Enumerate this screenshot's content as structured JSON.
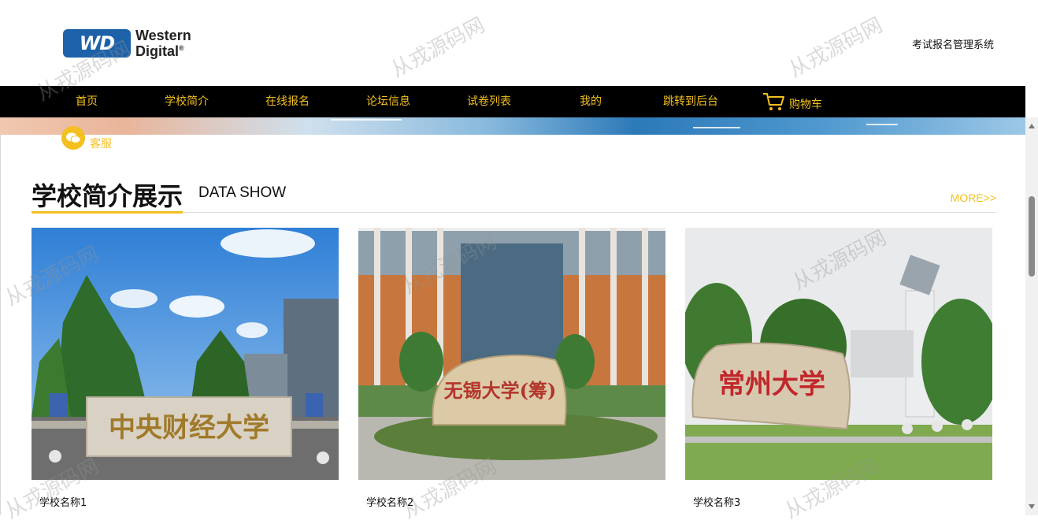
{
  "header": {
    "logo_badge": "WD",
    "logo_line1": "Western",
    "logo_line2": "Digital",
    "logo_mark": "®",
    "system_title": "考试报名管理系统"
  },
  "nav": {
    "items": [
      "首页",
      "学校简介",
      "在线报名",
      "论坛信息",
      "试卷列表",
      "我的",
      "跳转到后台"
    ],
    "cart_label": "购物车",
    "cart_icon": "cart-icon",
    "accent_color": "#f4c020",
    "background_color": "#000000"
  },
  "service": {
    "label": "客服",
    "icon": "chat-icon"
  },
  "section": {
    "title": "学校简介展示",
    "subtitle": "DATA SHOW",
    "more": "MORE>>"
  },
  "cards": [
    {
      "name": "学校名称1",
      "sign_text": "中央财经大学"
    },
    {
      "name": "学校名称2",
      "sign_text": "无锡大学(筹)"
    },
    {
      "name": "学校名称3",
      "sign_text": "常州大学"
    }
  ],
  "watermark": "从戎源码网"
}
